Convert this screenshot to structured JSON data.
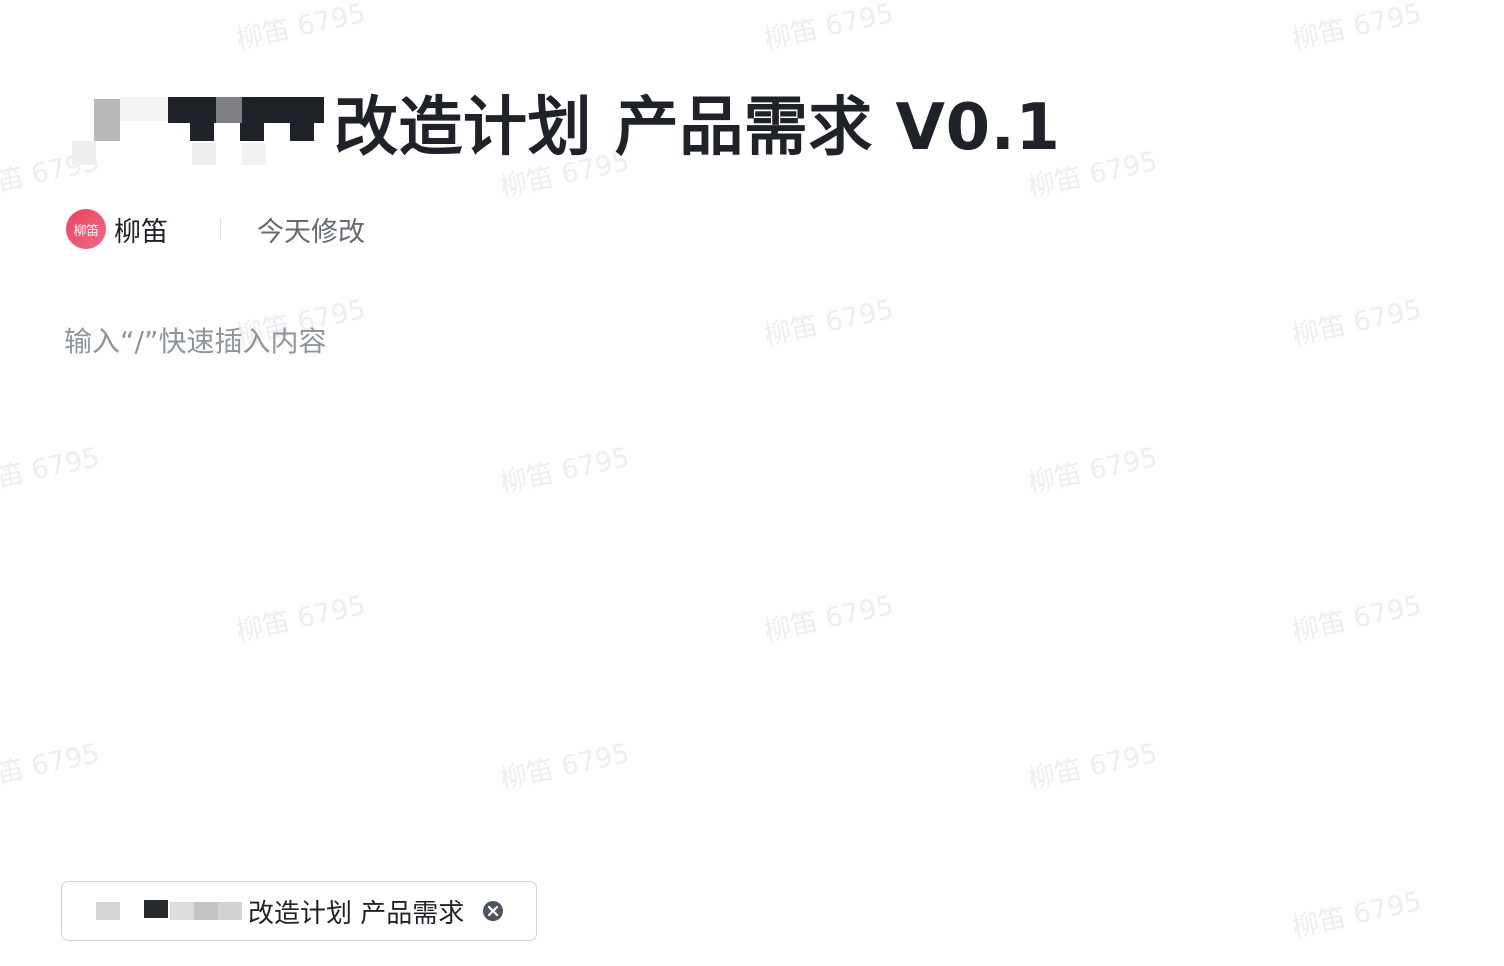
{
  "document": {
    "title": "改造计划 产品需求 V0.1",
    "author": {
      "avatar_text": "柳笛",
      "name": "柳笛"
    },
    "modified": "今天修改",
    "editor_placeholder": "输入“/”快速插入内容"
  },
  "tab_chip": {
    "label": "改造计划 产品需求",
    "close_icon": "close-circle-icon"
  },
  "watermark_text": "柳笛 6795",
  "colors": {
    "title": "#1f2329",
    "muted": "#646a73",
    "placeholder": "#8f959e",
    "avatar": "#e8455b",
    "watermark": "#ecedf0"
  }
}
